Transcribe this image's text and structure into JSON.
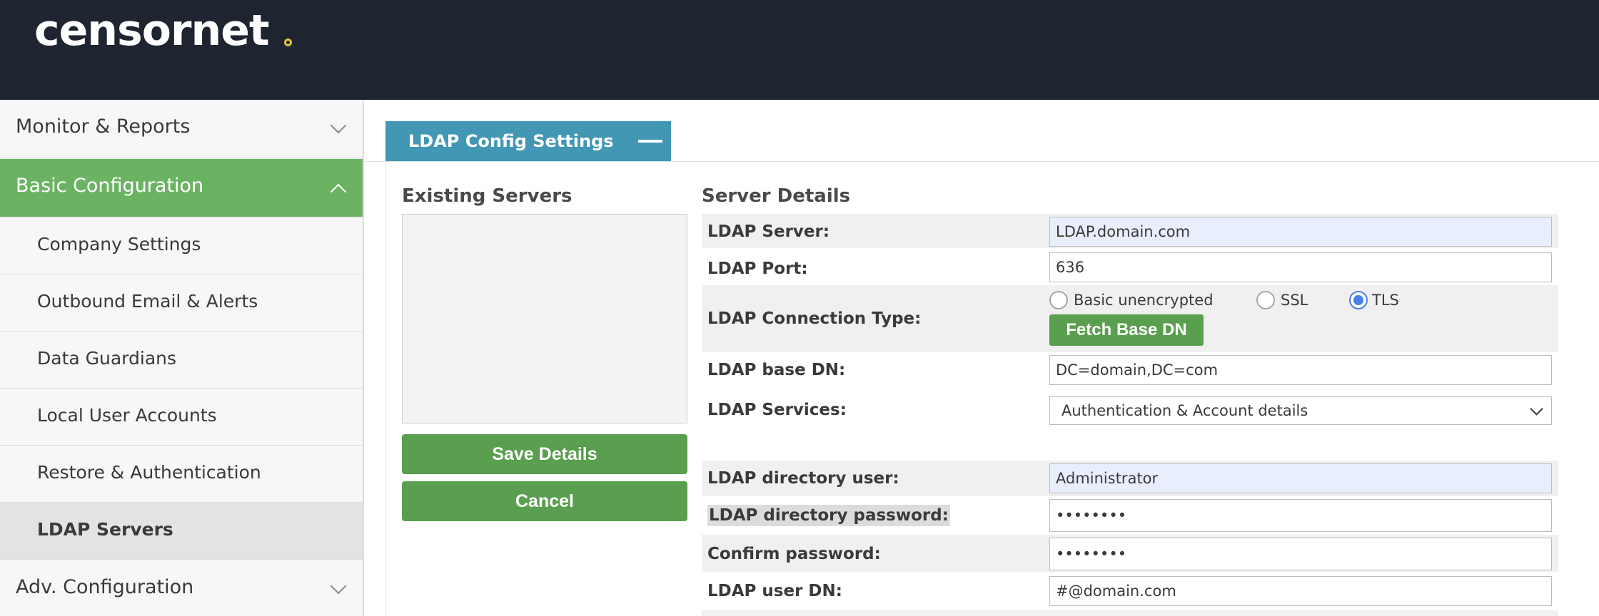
{
  "brand": {
    "name": "censornet"
  },
  "sidebar": {
    "sections": [
      {
        "label": "Monitor & Reports"
      },
      {
        "label": "Basic Configuration"
      },
      {
        "label": "Adv. Configuration"
      }
    ],
    "items": [
      {
        "label": "Company Settings"
      },
      {
        "label": "Outbound Email & Alerts"
      },
      {
        "label": "Data Guardians"
      },
      {
        "label": "Local User Accounts"
      },
      {
        "label": "Restore & Authentication"
      },
      {
        "label": "LDAP Servers"
      }
    ]
  },
  "panel": {
    "title": "LDAP Config Settings"
  },
  "existing": {
    "heading": "Existing Servers",
    "save_label": "Save Details",
    "cancel_label": "Cancel"
  },
  "details": {
    "heading": "Server Details",
    "server_label": "LDAP Server:",
    "server_value": "LDAP.domain.com",
    "port_label": "LDAP Port:",
    "port_value": "636",
    "conn_label": "LDAP Connection Type:",
    "conn_options": [
      "Basic unencrypted",
      "SSL",
      "TLS"
    ],
    "conn_selected": "TLS",
    "fetch_label": "Fetch Base DN",
    "basedn_label": "LDAP base DN:",
    "basedn_value": "DC=domain,DC=com",
    "services_label": "LDAP Services:",
    "services_value": "Authentication & Account details",
    "diruser_label": "LDAP directory user:",
    "diruser_value": "Administrator",
    "dirpass_label": "LDAP directory password:",
    "dirpass_value": "••••••••",
    "confirm_label": "Confirm password:",
    "confirm_value": "••••••••",
    "userdn_label": "LDAP user DN:",
    "userdn_value": "#@domain.com"
  },
  "colors": {
    "header": "#1e2530",
    "accent_green": "#6bb363",
    "button_green": "#5a9f4f",
    "tab_blue": "#4197b4",
    "logo_dot": "#e8c13a"
  }
}
